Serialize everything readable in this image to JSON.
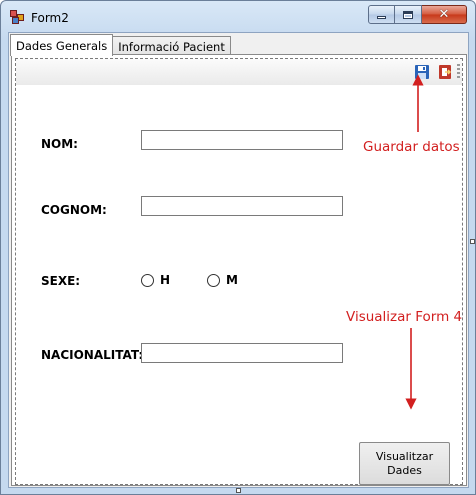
{
  "window": {
    "title": "Form2"
  },
  "tabs": [
    {
      "label": "Dades Generals",
      "active": true
    },
    {
      "label": "Informació Pacient",
      "active": false
    }
  ],
  "toolbar": {
    "save_icon": "save-icon",
    "exit_icon": "exit-icon"
  },
  "form": {
    "nom_label": "NOM:",
    "nom_value": "",
    "cognom_label": "COGNOM:",
    "cognom_value": "",
    "sexe_label": "SEXE:",
    "sexe_options": [
      "H",
      "M"
    ],
    "nacionalitat_label": "NACIONALITAT:",
    "nacionalitat_value": "",
    "visualitzar_button": "Visualitzar Dades"
  },
  "annotations": {
    "save": "Guardar datos",
    "form4": "Visualizar Form 4",
    "color": "#d21f1f"
  }
}
